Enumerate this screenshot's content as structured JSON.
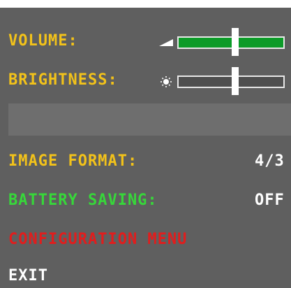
{
  "menu": {
    "volume": {
      "label": "VOLUME:",
      "level": 0.54,
      "icon": "volume-ramp-icon"
    },
    "brightness": {
      "label": "BRIGHTNESS:",
      "level": 0.54,
      "icon": "sun-icon"
    },
    "image_format": {
      "label": "IMAGE FORMAT:",
      "value": "4/3"
    },
    "battery_saving": {
      "label": "BATTERY SAVING:",
      "value": "OFF"
    },
    "configuration_menu": {
      "label": "CONFIGURATION MENU"
    },
    "exit": {
      "label": "EXIT"
    }
  },
  "colors": {
    "background": "#5f5f5f",
    "label_yellow": "#f2c21a",
    "label_green": "#37d73a",
    "label_red": "#e11d1d",
    "value_white": "#ffffff",
    "slider_fill": "#0c9b28"
  }
}
